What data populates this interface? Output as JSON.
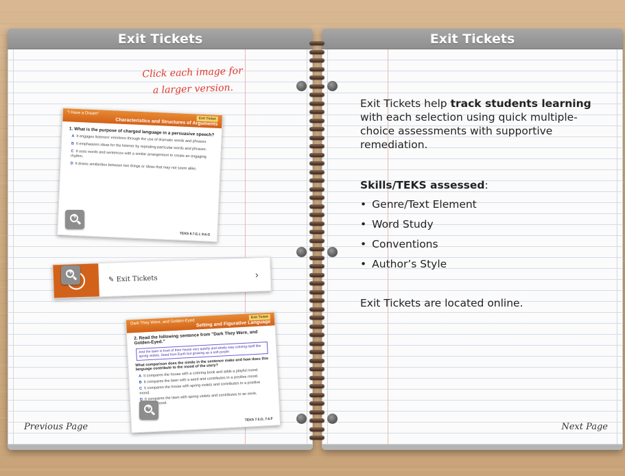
{
  "left_page": {
    "header": "Exit Tickets",
    "hint_line1": "Click each image for",
    "hint_line2": "a larger version.",
    "prev_label": "Previous Page",
    "thumb1": {
      "title": "\"I Have a Dream\"",
      "tag": "Exit Ticket",
      "subtitle": "Characteristics and Structures of Arguments",
      "question": "1. What is the purpose of charged language in a persuasive speech?",
      "options": [
        {
          "letter": "A",
          "text": "It engages listeners' emotions through the use of dramatic words and phrases."
        },
        {
          "letter": "B",
          "text": "It emphasizes ideas for the listener by repeating particular words and phrases."
        },
        {
          "letter": "C",
          "text": "It uses words and sentences with a similar arrangement to create an engaging rhythm."
        },
        {
          "letter": "D",
          "text": "It draws similarities between two things or ideas that may not seem alike."
        }
      ],
      "teks": "TEKS 8.7.E.i; 9.6.G"
    },
    "banner": {
      "label": "Exit Tickets",
      "chevron": "›"
    },
    "thumb2": {
      "title": "Dark They Were, and Golden-Eyed",
      "tag": "Exit Ticket",
      "subtitle": "Setting and Figurative Language",
      "question": "2. Read the following sentence from \"Dark They Were, and Golden-Eyed.\"",
      "quote": "And the lawn in front of their house very quietly and slowly was coloring itself like spring violets. Seed from Earth but growing up a soft purple.",
      "question2": "What comparison does the simile in the sentence make and how does this language contribute to the mood of the story?",
      "options": [
        {
          "letter": "A",
          "text": "It compares the house with a coloring book and adds a playful mood."
        },
        {
          "letter": "B",
          "text": "It compares the lawn with a seed and contributes to a positive mood."
        },
        {
          "letter": "C",
          "text": "It compares the house with spring violets and contributes to a positive mood."
        },
        {
          "letter": "D",
          "text": "It compares the lawn with spring violets and contributes to an eerie, unearthly mood."
        }
      ],
      "teks": "TEKS 7.6.D, 7.6.F"
    }
  },
  "right_page": {
    "header": "Exit Tickets",
    "intro_pre": "Exit Tickets help ",
    "intro_bold": "track students learning",
    "intro_post": " with each selection using quick multiple-choice assessments with supportive remediation.",
    "skills_heading": "Skills/TEKS assessed",
    "skills_colon": ":",
    "skills": [
      "Genre/Text Element",
      "Word Study",
      "Conventions",
      "Author’s Style"
    ],
    "location": "Exit Tickets are located online.",
    "next_label": "Next Page"
  },
  "colors": {
    "accent_orange": "#d2621a",
    "hint_red": "#e0352b",
    "header_gray": "#9a9a9a"
  }
}
